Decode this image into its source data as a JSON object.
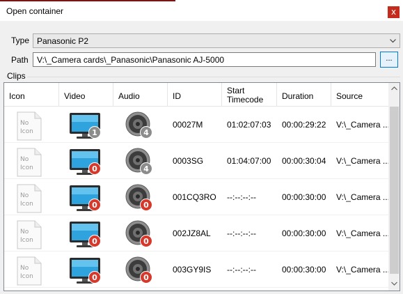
{
  "window": {
    "title": "Open container",
    "close_glyph": "x"
  },
  "form": {
    "type_label": "Type",
    "type_value": "Panasonic P2",
    "path_label": "Path",
    "path_value": "V:\\_Camera cards\\_Panasonic\\Panasonic AJ-5000",
    "browse_label": "..."
  },
  "clips": {
    "legend": "Clips",
    "columns": {
      "icon": "Icon",
      "video": "Video",
      "audio": "Audio",
      "id": "ID",
      "start_tc_1": "Start",
      "start_tc_2": "Timecode",
      "duration": "Duration",
      "source": "Source"
    },
    "no_icon_1": "No",
    "no_icon_2": "Icon",
    "rows": [
      {
        "video_count": "1",
        "audio_count": "4",
        "id": "00027M",
        "start_timecode": "01:02:07:03",
        "duration": "00:00:29:22",
        "source": "V:\\_Camera ..."
      },
      {
        "video_count": "0",
        "audio_count": "4",
        "id": "0003SG",
        "start_timecode": "01:04:07:00",
        "duration": "00:00:30:04",
        "source": "V:\\_Camera ..."
      },
      {
        "video_count": "0",
        "audio_count": "0",
        "id": "001CQ3RO",
        "start_timecode": "--:--:--:--",
        "duration": "00:00:30:00",
        "source": "V:\\_Camera ..."
      },
      {
        "video_count": "0",
        "audio_count": "0",
        "id": "002JZ8AL",
        "start_timecode": "--:--:--:--",
        "duration": "00:00:30:00",
        "source": "V:\\_Camera ..."
      },
      {
        "video_count": "0",
        "audio_count": "0",
        "id": "003GY9IS",
        "start_timecode": "--:--:--:--",
        "duration": "00:00:30:00",
        "source": "V:\\_Camera ..."
      }
    ]
  },
  "colors": {
    "badge_zero": "#d6382b",
    "badge_nonzero": "#8c8c8c",
    "close_button": "#c42b1c",
    "focus_border": "#0078d7"
  },
  "icons": {
    "no_icon": "no-icon-placeholder",
    "video": "monitor-icon",
    "audio": "speaker-icon",
    "dropdown": "chevron-down-icon"
  }
}
